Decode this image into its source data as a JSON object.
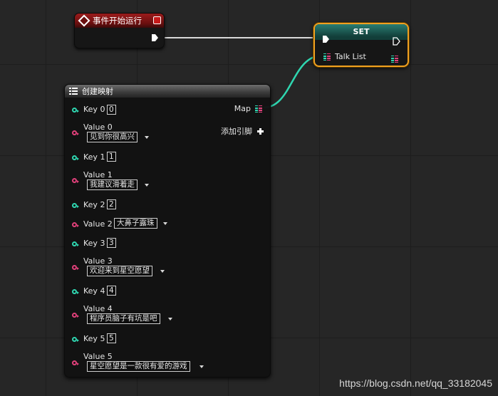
{
  "event_node": {
    "title": "事件开始运行"
  },
  "set_node": {
    "title": "SET",
    "pin_label": "Talk List"
  },
  "map_node": {
    "title": "创建映射",
    "output_label": "Map",
    "add_pin_label": "添加引脚",
    "entries": [
      {
        "key_label": "Key 0",
        "key_value": "0",
        "value_label": "Value 0",
        "value": "见到你很高兴"
      },
      {
        "key_label": "Key 1",
        "key_value": "1",
        "value_label": "Value 1",
        "value": "我建议滑着走"
      },
      {
        "key_label": "Key 2",
        "key_value": "2",
        "value_label": "Value 2",
        "value": "大鼻子露珠"
      },
      {
        "key_label": "Key 3",
        "key_value": "3",
        "value_label": "Value 3",
        "value": "欢迎来到星空愿望"
      },
      {
        "key_label": "Key 4",
        "key_value": "4",
        "value_label": "Value 4",
        "value": "程序员脑子有坑是吧"
      },
      {
        "key_label": "Key 5",
        "key_value": "5",
        "value_label": "Value 5",
        "value": "星空愿望是一款很有爱的游戏"
      }
    ]
  },
  "watermark": "https://blog.csdn.net/qq_33182045",
  "colors": {
    "key_pin": "#2fd6b0",
    "value_pin": "#e0407a",
    "selection": "#f0a020",
    "event_header": "#9a1b1b",
    "set_header": "#2a7d72"
  }
}
